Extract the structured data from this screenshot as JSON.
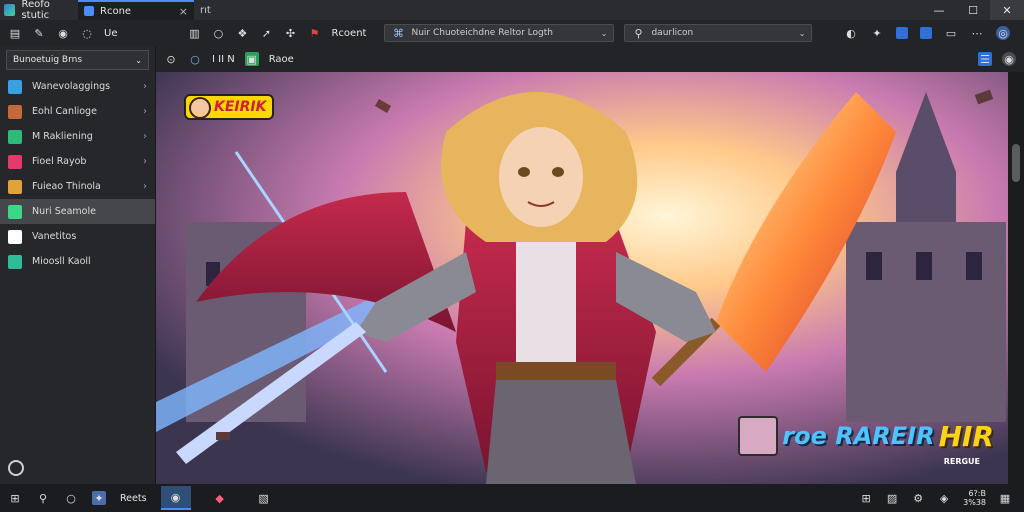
{
  "window": {
    "app_name": "Reofo stutic",
    "tab_title": "Rcone",
    "tab_close": "×",
    "new_tab": "rıt",
    "controls": {
      "minimize": "—",
      "maximize": "☐",
      "close": "✕"
    }
  },
  "toolbar": {
    "left_label": "Ue",
    "bookmark_label": "Rcoent",
    "url_text": "Nuir Chuoteichdne Reltor Logth",
    "search_placeholder": "daurlicon"
  },
  "sidebar": {
    "dropdown_label": "Bunoetuig Brns",
    "items": [
      {
        "label": "Wanevolaggings",
        "icon_color": "#3aa0e0",
        "has_arrow": true
      },
      {
        "label": "Eohl Canlioge",
        "icon_color": "#c46a3a",
        "has_arrow": true
      },
      {
        "label": "M Rakliening",
        "icon_color": "#2dbb7a",
        "has_arrow": true
      },
      {
        "label": "Fioel Rayob",
        "icon_color": "#e23a6a",
        "has_arrow": true
      },
      {
        "label": "Fuieao Thinola",
        "icon_color": "#e0a23a",
        "has_arrow": true
      },
      {
        "label": "Nuri Seamole",
        "icon_color": "#3dd58a",
        "has_arrow": false,
        "active": true
      },
      {
        "label": "Vanetitos",
        "icon_color": "#ffffff",
        "has_arrow": false
      },
      {
        "label": "Mioosll Kaoll",
        "icon_color": "#2dbb9a",
        "has_arrow": false
      }
    ]
  },
  "subbar": {
    "label_a": "I II N",
    "label_b": "Raoe"
  },
  "artwork": {
    "badge_top_left": "KEIRIK",
    "badge_bottom_right_a": "roe RAREIR",
    "badge_bottom_right_b": "HIR",
    "badge_bottom_right_sub": "RERGUE"
  },
  "taskbar": {
    "app_label": "Reets",
    "clock_time": "6?:B",
    "clock_date": "3%38"
  }
}
